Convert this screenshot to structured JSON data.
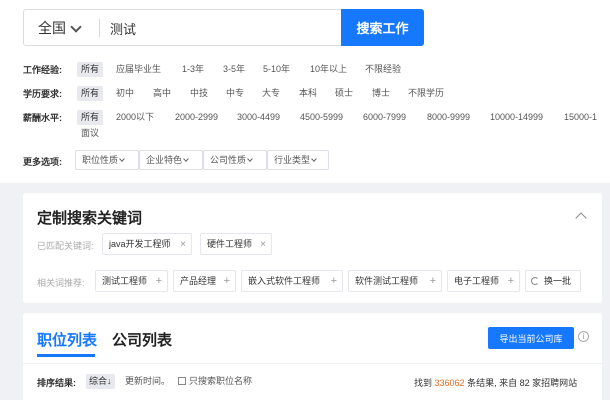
{
  "search": {
    "region": "全国",
    "query": "测试",
    "button_label": "搜索工作"
  },
  "filters": {
    "experience": {
      "label": "工作经验:",
      "options": [
        "所有",
        "应届毕业生",
        "1-3年",
        "3-5年",
        "5-10年",
        "10年以上",
        "不限经验"
      ]
    },
    "education": {
      "label": "学历要求:",
      "options": [
        "所有",
        "初中",
        "高中",
        "中技",
        "中专",
        "大专",
        "本科",
        "硕士",
        "博士",
        "不限学历"
      ]
    },
    "salary": {
      "label": "薪酬水平:",
      "options": [
        "所有",
        "2000以下",
        "2000-2999",
        "3000-4499",
        "4500-5999",
        "6000-7999",
        "8000-9999",
        "10000-14999",
        "15000-1",
        "面议"
      ]
    },
    "more": {
      "label": "更多选项:",
      "dropdowns": [
        "职位性质",
        "企业特色",
        "公司性质",
        "行业类型"
      ]
    }
  },
  "keywords": {
    "title": "定制搜索关键词",
    "matched_label": "已匹配关键词:",
    "matched": [
      "java开发工程师",
      "硬件工程师"
    ],
    "related_label": "相关词推荐:",
    "related": [
      "测试工程师",
      "产品经理",
      "嵌入式软件工程师",
      "软件测试工程师",
      "电子工程师"
    ],
    "refresh_label": "换一批"
  },
  "list": {
    "tabs": [
      "职位列表",
      "公司列表"
    ],
    "export_label": "导出当前公司库",
    "sort_label": "排序结果:",
    "sort_options": [
      "综合",
      "更新时间"
    ],
    "title_only_label": "只搜索职位名称",
    "result_prefix": "找到 ",
    "result_count": "336062",
    "result_suffix": " 条结果, 来自 82 家招聘网站"
  },
  "colors": {
    "accent": "#1677ff",
    "count": "#e06b1f"
  }
}
